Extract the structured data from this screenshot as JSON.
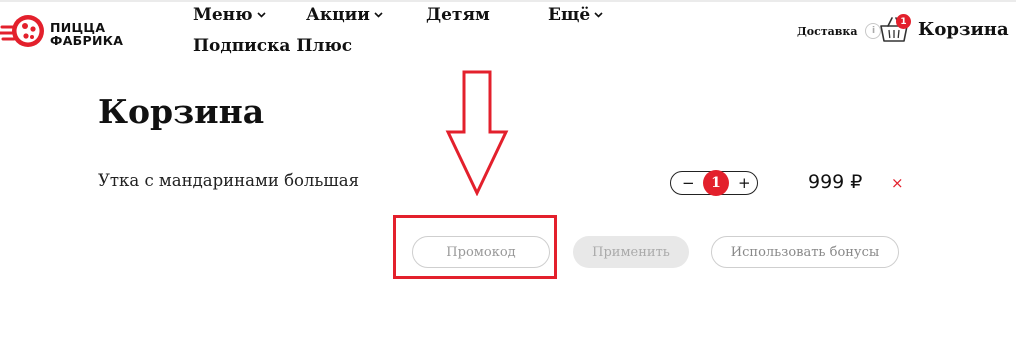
{
  "logo": {
    "line1": "ПИЦЦА",
    "line2": "ФАБРИКА"
  },
  "nav": {
    "menu": "Меню",
    "promotions": "Акции",
    "kids": "Детям",
    "more": "Ещё",
    "subscription": "Подписка Плюс"
  },
  "header": {
    "delivery": "Доставка",
    "delivery_info": "i",
    "cart_label": "Корзина",
    "cart_count": "1"
  },
  "page": {
    "title": "Корзина"
  },
  "cart": {
    "items": [
      {
        "name": "Утка с мандаринами большая",
        "quantity": "1",
        "price": "999 ₽",
        "minus": "−",
        "plus": "+",
        "remove": "×"
      }
    ]
  },
  "actions": {
    "promo_placeholder": "Промокод",
    "apply": "Применить",
    "use_bonuses": "Использовать бонусы"
  },
  "colors": {
    "accent": "#e3202c"
  }
}
